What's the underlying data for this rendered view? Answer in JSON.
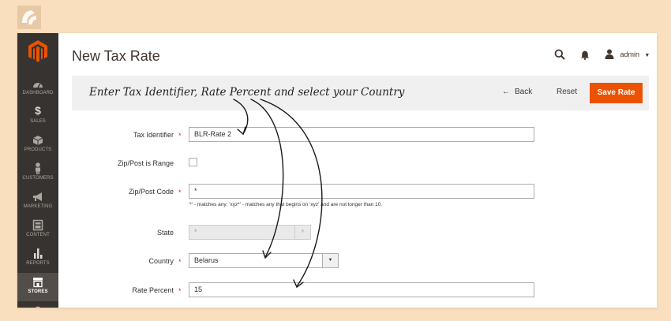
{
  "colors": {
    "accent": "#eb5202",
    "sidebar_bg": "#373330",
    "page_bg": "#f9dfbe"
  },
  "sidebar": {
    "items": [
      {
        "label": "DASHBOARD",
        "icon": "dashboard-icon"
      },
      {
        "label": "SALES",
        "icon": "dollar-icon"
      },
      {
        "label": "PRODUCTS",
        "icon": "cube-icon"
      },
      {
        "label": "CUSTOMERS",
        "icon": "person-icon"
      },
      {
        "label": "MARKETING",
        "icon": "megaphone-icon"
      },
      {
        "label": "CONTENT",
        "icon": "layout-icon"
      },
      {
        "label": "REPORTS",
        "icon": "bar-chart-icon"
      },
      {
        "label": "STORES",
        "icon": "store-icon",
        "active": true
      },
      {
        "label": "",
        "icon": "gear-icon"
      }
    ]
  },
  "header": {
    "title": "New Tax Rate",
    "user_label": "admin"
  },
  "action_bar": {
    "annotation": "Enter Tax Identifier, Rate Percent and select your Country",
    "back_label": "Back",
    "reset_label": "Reset",
    "save_label": "Save Rate"
  },
  "form": {
    "tax_identifier": {
      "label": "Tax Identifier",
      "required": "*",
      "value": "BLR-Rate 2"
    },
    "zip_is_range": {
      "label": "Zip/Post is Range"
    },
    "zip_code": {
      "label": "Zip/Post Code",
      "required": "*",
      "value": "*",
      "hint": "'*' - matches any; 'xyz*' - matches any that begins on 'xyz' and are not longer than 10."
    },
    "state": {
      "label": "State",
      "value": "*"
    },
    "country": {
      "label": "Country",
      "required": "*",
      "value": "Belarus"
    },
    "rate_percent": {
      "label": "Rate Percent",
      "required": "*",
      "value": "15"
    }
  }
}
